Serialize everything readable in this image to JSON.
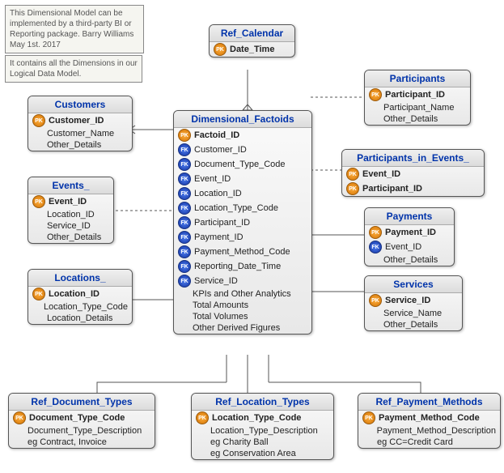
{
  "notes": {
    "top": "This Dimensional Model can be implemented by a third-party BI or Reporting package. Barry Williams May 1st. 2017",
    "second": "It contains all the Dimensions in our Logical Data Model."
  },
  "entities": {
    "ref_calendar": {
      "title": "Ref_Calendar",
      "attrs": [
        {
          "key": "pk",
          "name": "Date_Time",
          "bold": true
        }
      ]
    },
    "customers": {
      "title": "Customers",
      "attrs": [
        {
          "key": "pk",
          "name": "Customer_ID",
          "bold": true
        },
        {
          "key": "",
          "name": "Customer_Name"
        },
        {
          "key": "",
          "name": "Other_Details"
        }
      ]
    },
    "events": {
      "title": "Events_",
      "attrs": [
        {
          "key": "pk",
          "name": "Event_ID",
          "bold": true
        },
        {
          "key": "",
          "name": "Location_ID"
        },
        {
          "key": "",
          "name": "Service_ID"
        },
        {
          "key": "",
          "name": "Other_Details"
        }
      ]
    },
    "locations": {
      "title": "Locations_",
      "attrs": [
        {
          "key": "pk",
          "name": "Location_ID",
          "bold": true
        },
        {
          "key": "",
          "name": "Location_Type_Code"
        },
        {
          "key": "",
          "name": "Location_Details"
        }
      ]
    },
    "participants": {
      "title": "Participants",
      "attrs": [
        {
          "key": "pk",
          "name": "Participant_ID",
          "bold": true
        },
        {
          "key": "",
          "name": "Participant_Name"
        },
        {
          "key": "",
          "name": "Other_Details"
        }
      ]
    },
    "participants_in_events": {
      "title": "Participants_in_Events_",
      "attrs": [
        {
          "key": "pk",
          "name": "Event_ID",
          "bold": true
        },
        {
          "key": "pk",
          "name": "Participant_ID",
          "bold": true
        }
      ]
    },
    "payments": {
      "title": "Payments",
      "attrs": [
        {
          "key": "pk",
          "name": "Payment_ID",
          "bold": true
        },
        {
          "key": "fk",
          "name": "Event_ID"
        },
        {
          "key": "",
          "name": "Other_Details"
        }
      ]
    },
    "services": {
      "title": "Services",
      "attrs": [
        {
          "key": "pk",
          "name": "Service_ID",
          "bold": true
        },
        {
          "key": "",
          "name": "Service_Name"
        },
        {
          "key": "",
          "name": "Other_Details"
        }
      ]
    },
    "factoids": {
      "title": "Dimensional_Factoids",
      "attrs": [
        {
          "key": "pk",
          "name": "Factoid_ID",
          "bold": true
        },
        {
          "key": "fk",
          "name": "Customer_ID"
        },
        {
          "key": "fk",
          "name": "Document_Type_Code"
        },
        {
          "key": "fk",
          "name": "Event_ID"
        },
        {
          "key": "fk",
          "name": "Location_ID"
        },
        {
          "key": "fk",
          "name": "Location_Type_Code"
        },
        {
          "key": "fk",
          "name": "Participant_ID"
        },
        {
          "key": "fk",
          "name": "Payment_ID"
        },
        {
          "key": "fk",
          "name": "Payment_Method_Code"
        },
        {
          "key": "fk",
          "name": "Reporting_Date_Time"
        },
        {
          "key": "fk",
          "name": "Service_ID"
        },
        {
          "key": "",
          "name": "KPIs and Other Analytics"
        },
        {
          "key": "",
          "name": "Total Amounts"
        },
        {
          "key": "",
          "name": "Total Volumes"
        },
        {
          "key": "",
          "name": "Other Derived Figures"
        }
      ]
    },
    "ref_document_types": {
      "title": "Ref_Document_Types",
      "attrs": [
        {
          "key": "pk",
          "name": "Document_Type_Code",
          "bold": true
        },
        {
          "key": "",
          "name": "Document_Type_Description"
        },
        {
          "key": "",
          "name": "eg Contract, Invoice"
        }
      ]
    },
    "ref_location_types": {
      "title": "Ref_Location_Types",
      "attrs": [
        {
          "key": "pk",
          "name": "Location_Type_Code",
          "bold": true
        },
        {
          "key": "",
          "name": "Location_Type_Description"
        },
        {
          "key": "",
          "name": "eg Charity Ball"
        },
        {
          "key": "",
          "name": "eg Conservation Area"
        }
      ]
    },
    "ref_payment_methods": {
      "title": "Ref_Payment_Methods",
      "attrs": [
        {
          "key": "pk",
          "name": "Payment_Method_Code",
          "bold": true
        },
        {
          "key": "",
          "name": "Payment_Method_Description"
        },
        {
          "key": "",
          "name": "eg CC=Credit Card"
        }
      ]
    }
  }
}
